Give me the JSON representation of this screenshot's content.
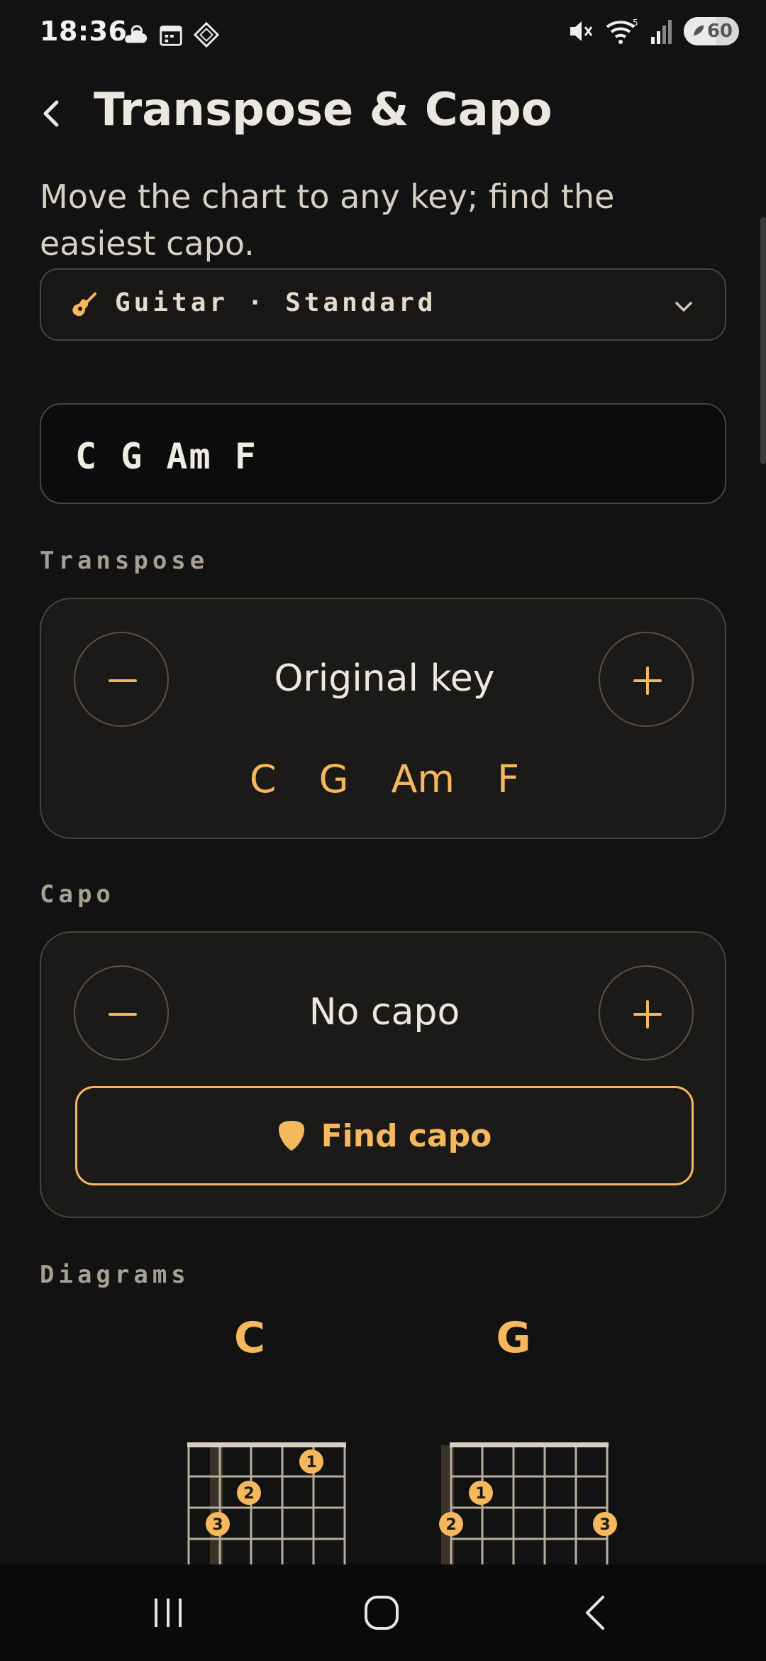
{
  "status_bar": {
    "time": "18:36",
    "battery": "60",
    "icons": [
      "weather-icon",
      "calendar-icon",
      "app-icon",
      "mute-icon",
      "wifi-icon",
      "signal-icon",
      "battery-icon"
    ]
  },
  "header": {
    "title": "Transpose & Capo",
    "subtitle": "Move the chart to any key; find the easiest capo."
  },
  "instrument_select": {
    "value": "Guitar · Standard"
  },
  "chords_input": {
    "value": "C G Am F"
  },
  "transpose": {
    "section_label": "Transpose",
    "value_label": "Original key",
    "chords": [
      "C",
      "G",
      "Am",
      "F"
    ]
  },
  "capo": {
    "section_label": "Capo",
    "value_label": "No capo",
    "find_button": "Find capo"
  },
  "diagrams": {
    "section_label": "Diagrams",
    "chords": [
      {
        "name": "C",
        "fingers": [
          "1",
          "2",
          "3"
        ]
      },
      {
        "name": "G",
        "fingers": [
          "1",
          "2",
          "3"
        ]
      }
    ]
  },
  "colors": {
    "accent": "#f5b85c",
    "background": "#121212",
    "card": "#1b1a19",
    "border": "#4a4338"
  }
}
